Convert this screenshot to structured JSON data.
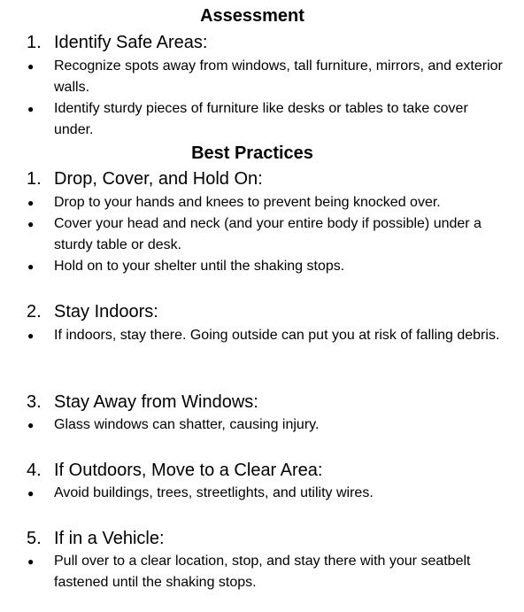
{
  "assessment": {
    "heading": "Assessment",
    "items": [
      {
        "number": "1.",
        "title": "Identify Safe Areas:",
        "bullets": [
          "Recognize spots away from windows, tall furniture, mirrors, and exterior walls.",
          "Identify sturdy pieces of furniture like desks or tables to take cover under."
        ]
      }
    ]
  },
  "best_practices": {
    "heading": "Best Practices",
    "items": [
      {
        "number": "1.",
        "title": "Drop, Cover, and Hold On:",
        "bullets": [
          "Drop to your hands and knees to prevent being knocked over.",
          "Cover your head and neck (and your entire body if possible) under a sturdy table or desk.",
          "Hold on to your shelter until the shaking stops."
        ]
      },
      {
        "number": "2.",
        "title": "Stay Indoors:",
        "bullets": [
          "If indoors, stay there. Going outside can put you at risk of falling debris."
        ]
      },
      {
        "number": "3.",
        "title": "Stay Away from Windows:",
        "bullets": [
          "Glass windows can shatter, causing injury."
        ]
      },
      {
        "number": "4.",
        "title": "If Outdoors, Move to a Clear Area:",
        "bullets": [
          "Avoid buildings, trees, streetlights, and utility wires."
        ]
      },
      {
        "number": "5.",
        "title": "If in a Vehicle:",
        "bullets": [
          "Pull over to a clear location, stop, and stay there with your seatbelt fastened until the shaking stops."
        ]
      }
    ]
  },
  "bullet_glyph": "●"
}
